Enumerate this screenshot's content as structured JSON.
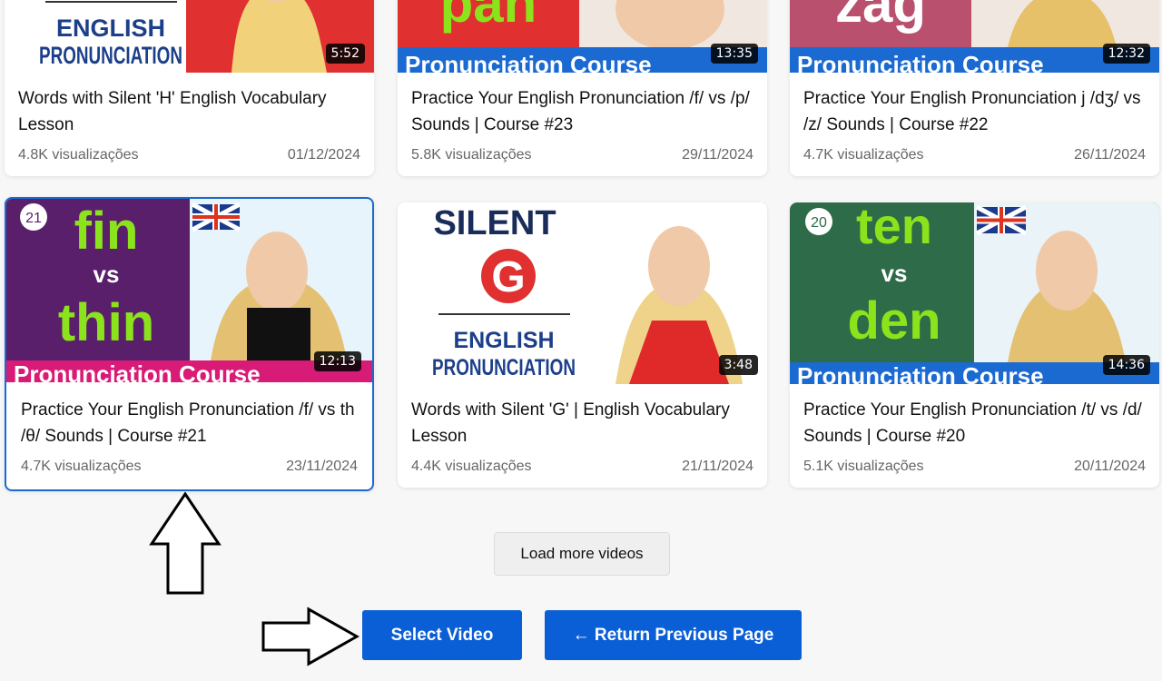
{
  "videos": [
    {
      "title": "Words with Silent 'H' English Vocabulary Lesson",
      "views": "4.8K visualizações",
      "date": "01/12/2024",
      "duration": "5:52",
      "thumb_text": [
        "ENGLISH",
        "PRONUNCIATION"
      ]
    },
    {
      "title": "Practice Your English Pronunciation /f/ vs /p/ Sounds | Course #23",
      "views": "5.8K visualizações",
      "date": "29/11/2024",
      "duration": "13:35",
      "thumb_text": [
        "pan",
        "Pronunciation Course"
      ]
    },
    {
      "title": "Practice Your English Pronunciation j /dʒ/ vs /z/ Sounds | Course #22",
      "views": "4.7K visualizações",
      "date": "26/11/2024",
      "duration": "12:32",
      "thumb_text": [
        "zag",
        "Pronunciation Course"
      ]
    },
    {
      "title": "Practice Your English Pronunciation /f/ vs th /θ/ Sounds | Course #21",
      "views": "4.7K visualizações",
      "date": "23/11/2024",
      "duration": "12:13",
      "thumb_text": [
        "21",
        "fin",
        "vs",
        "thin",
        "Pronunciation Course"
      ]
    },
    {
      "title": "Words with Silent 'G' | English Vocabulary Lesson",
      "views": "4.4K visualizações",
      "date": "21/11/2024",
      "duration": "3:48",
      "thumb_text": [
        "SILENT",
        "G",
        "ENGLISH",
        "PRONUNCIATION"
      ]
    },
    {
      "title": "Practice Your English Pronunciation /t/ vs /d/ Sounds | Course #20",
      "views": "5.1K visualizações",
      "date": "20/11/2024",
      "duration": "14:36",
      "thumb_text": [
        "20",
        "ten",
        "vs",
        "den",
        "Pronunciation Course"
      ]
    }
  ],
  "load_more_label": "Load more videos",
  "select_video_label": "Select Video",
  "return_label": "← Return Previous Page",
  "colors": {
    "primary_button": "#0b5fd6",
    "selected_border": "#1a6ad1",
    "lime": "#8be31c",
    "purple": "#5a1f6b",
    "green": "#2e6b49"
  }
}
